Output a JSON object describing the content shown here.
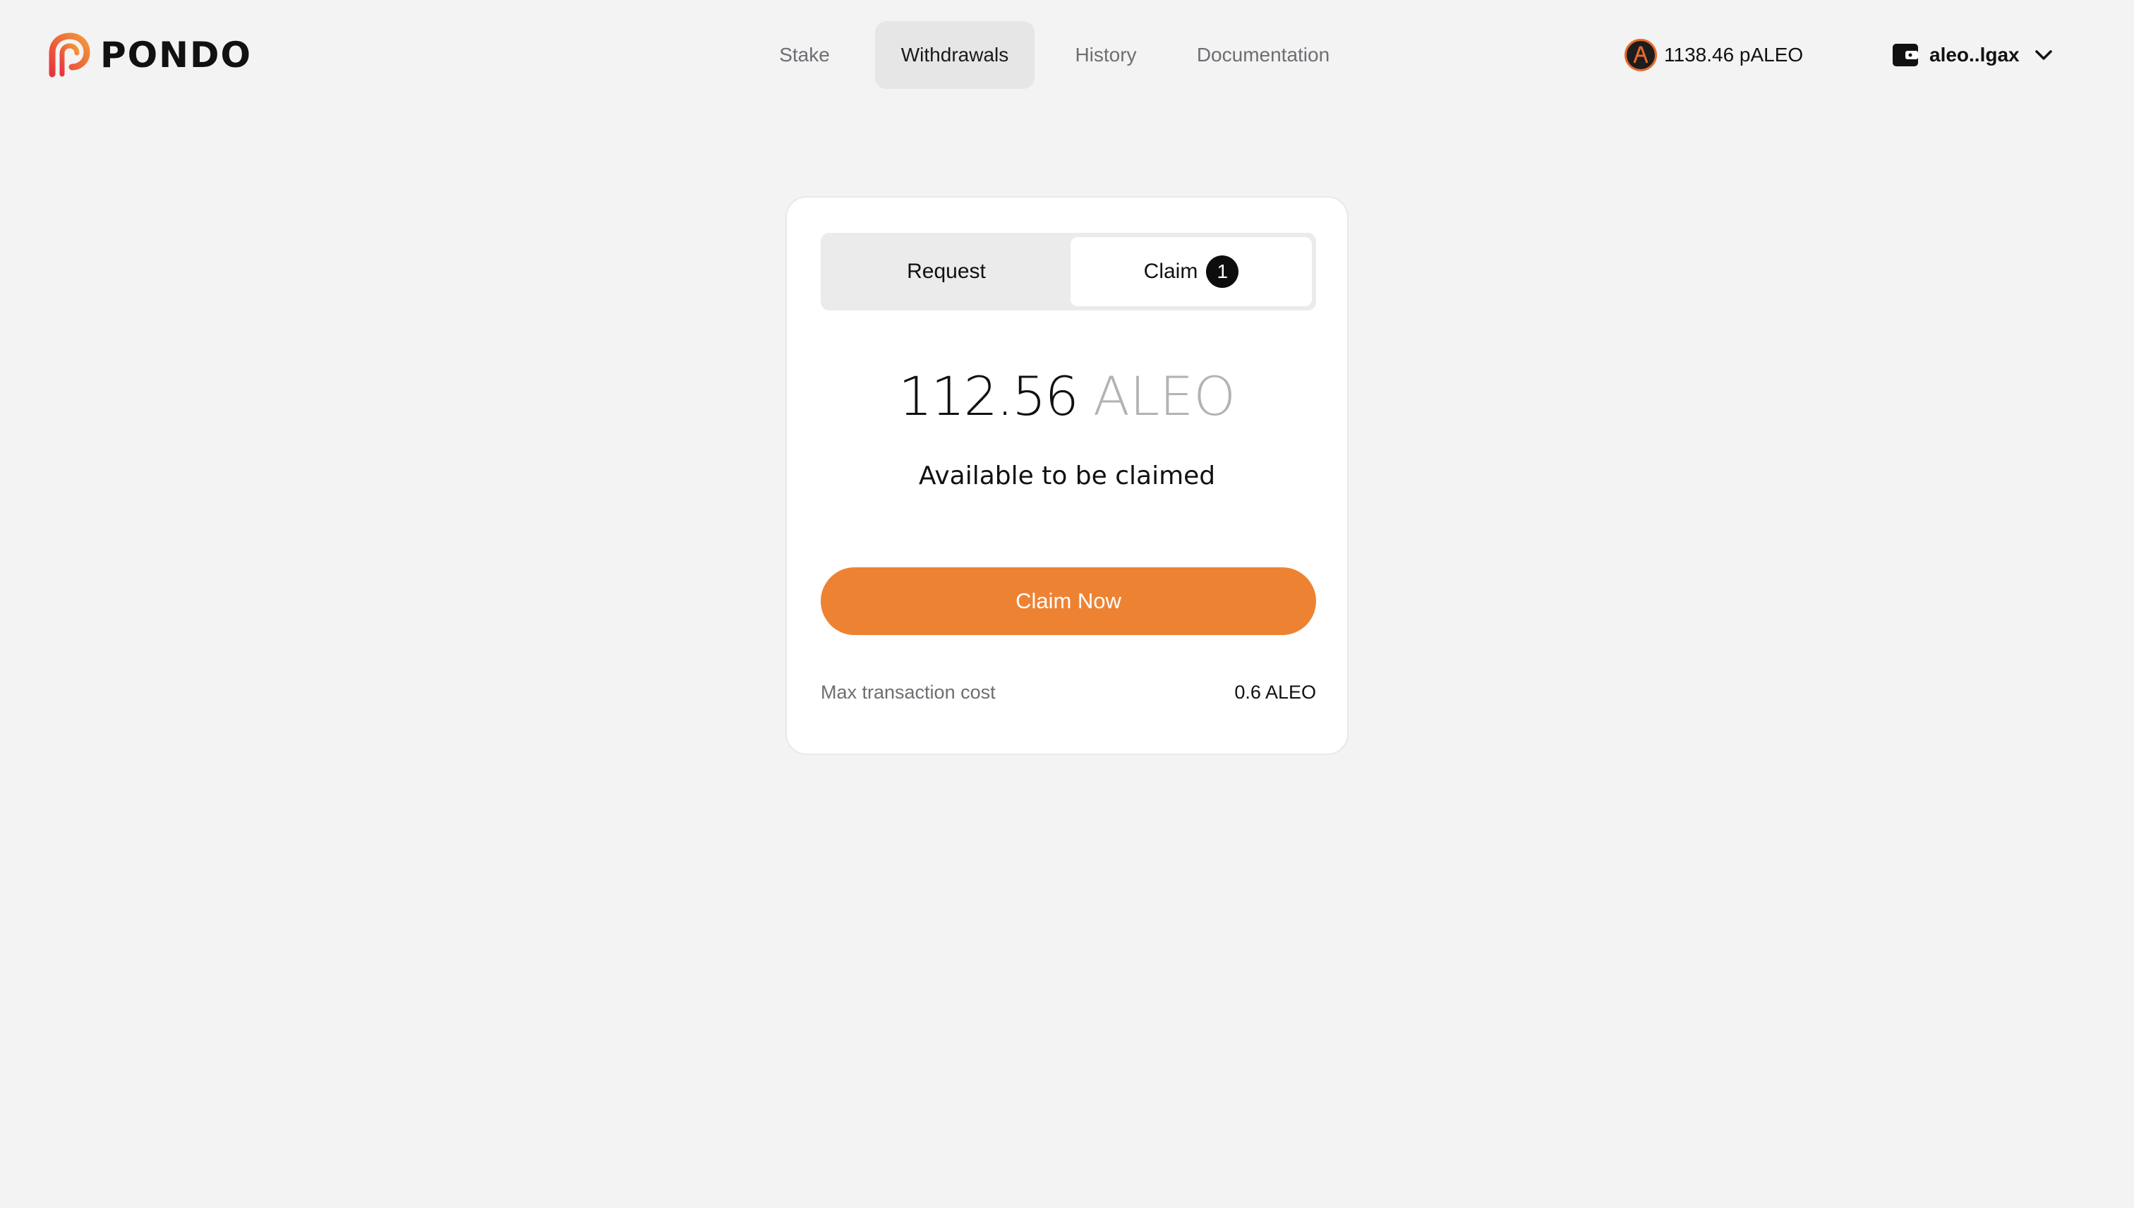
{
  "brand": {
    "name": "PONDO",
    "accent_color": "#ee8233"
  },
  "nav": {
    "items": [
      {
        "label": "Stake",
        "active": false
      },
      {
        "label": "Withdrawals",
        "active": true
      },
      {
        "label": "History",
        "active": false
      },
      {
        "label": "Documentation",
        "active": false
      }
    ]
  },
  "account": {
    "balance": "1138.46 pALEO",
    "balance_icon": "aleo-coin-icon",
    "wallet_address": "aleo..lgax",
    "wallet_icon": "wallet-icon"
  },
  "withdraw_card": {
    "tabs": {
      "request_label": "Request",
      "claim_label": "Claim",
      "claim_badge": "1",
      "active": "Claim"
    },
    "amount": "112.56",
    "amount_unit": "ALEO",
    "amount_caption": "Available to be claimed",
    "claim_button_label": "Claim Now",
    "cost_label": "Max transaction cost",
    "cost_value": "0.6 ALEO"
  }
}
